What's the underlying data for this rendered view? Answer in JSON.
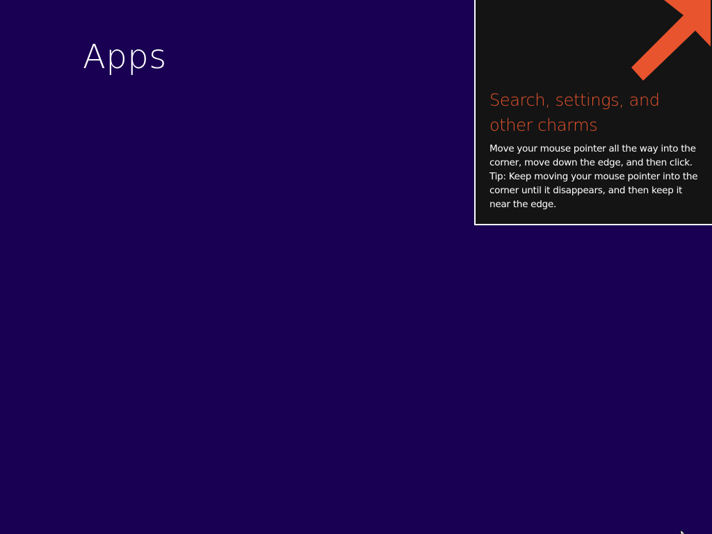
{
  "start_screen": {
    "title": "Apps"
  },
  "charms_tip": {
    "heading": "Search, settings, and other charms",
    "body": "Move your mouse pointer all the way into the corner, move down the edge, and then click. Tip: Keep moving your mouse pointer into the corner until it disappears, and then keep it near the edge.",
    "arrow_icon": "arrow-up-right-icon",
    "accent_color": "#e8542d"
  },
  "colors": {
    "background": "#190052",
    "tip_background": "#141414",
    "tip_border": "#ffffff",
    "text": "#ffffff"
  },
  "cursor": {
    "icon": "mouse-pointer-icon"
  }
}
